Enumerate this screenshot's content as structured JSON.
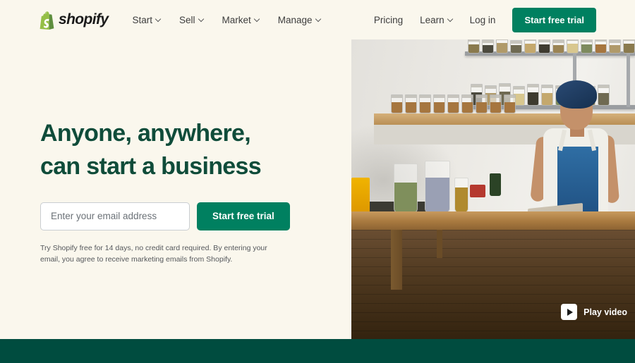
{
  "colors": {
    "background": "#faf7ed",
    "brand_green": "#008060",
    "heading_green": "#0f4c3a",
    "footer_green": "#004c3f",
    "logo_green": "#95bf47",
    "text_dark": "#3d3d3d"
  },
  "header": {
    "logo": {
      "icon": "shopify-bag-icon",
      "wordmark": "shopify"
    },
    "nav_left": [
      {
        "label": "Start",
        "icon": "chevron-down-icon"
      },
      {
        "label": "Sell",
        "icon": "chevron-down-icon"
      },
      {
        "label": "Market",
        "icon": "chevron-down-icon"
      },
      {
        "label": "Manage",
        "icon": "chevron-down-icon"
      }
    ],
    "nav_right": [
      {
        "label": "Pricing",
        "has_chevron": false
      },
      {
        "label": "Learn",
        "has_chevron": true
      },
      {
        "label": "Log in",
        "has_chevron": false
      }
    ],
    "cta_label": "Start free trial"
  },
  "hero": {
    "title_line1": "Anyone, anywhere,",
    "title_line2": "can start a business",
    "email_placeholder": "Enter your email address",
    "email_value": "",
    "cta_label": "Start free trial",
    "fineprint": "Try Shopify free for 14 days, no credit card required. By entering your email, you agree to receive marketing emails from Shopify."
  },
  "media": {
    "alt": "Woman in blue headwrap and denim apron working at a wooden table in a shop with shelves of glass jars",
    "play_video_label": "Play video",
    "play_icon": "play-triangle-icon"
  }
}
